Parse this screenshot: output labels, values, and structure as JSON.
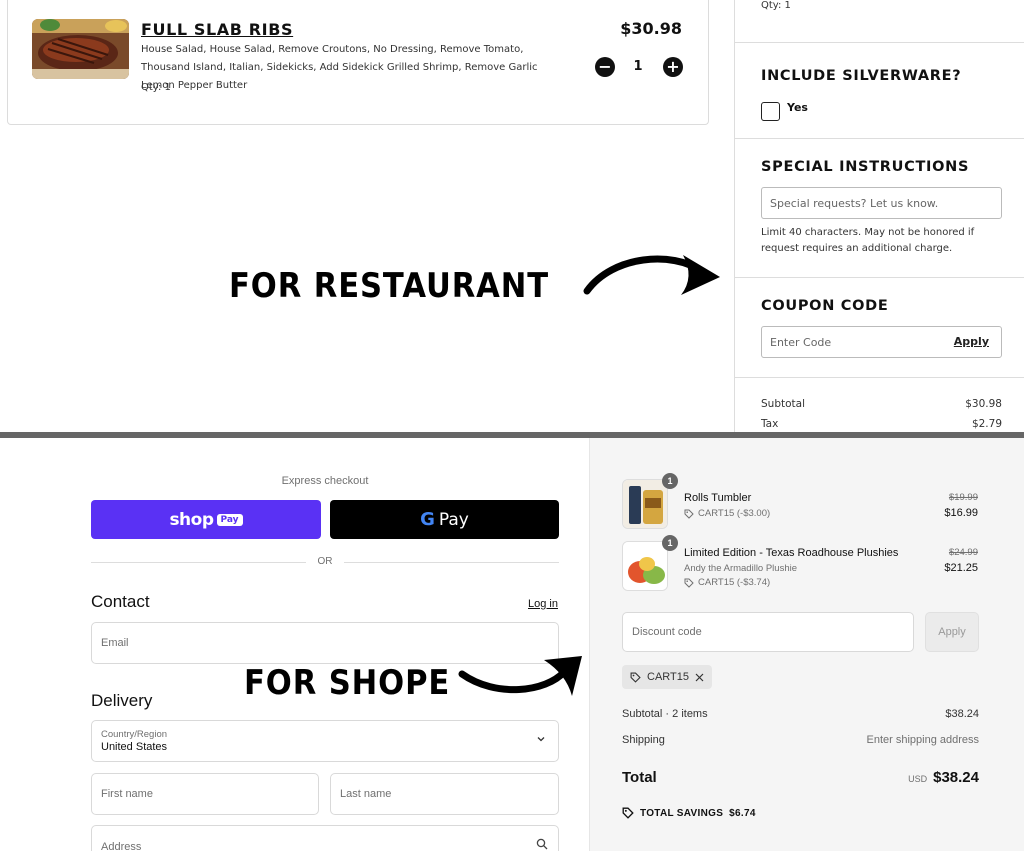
{
  "restaurant": {
    "label": "FOR RESTAURANT",
    "item": {
      "title": "FULL SLAB RIBS",
      "description": "House Salad, House Salad, Remove Croutons, No Dressing, Remove Tomato, Thousand Island, Italian, Sidekicks, Add Sidekick Grilled Shrimp, Remove Garlic Lemon Pepper Butter",
      "qty": "Qty: 1",
      "price": "$30.98",
      "quantity": "1",
      "minus": "−",
      "plus": "+"
    },
    "sidebar": {
      "prev_qty": "Qty: 1",
      "silverware_heading": "INCLUDE SILVERWARE?",
      "silverware_option": "Yes",
      "instructions_heading": "SPECIAL INSTRUCTIONS",
      "instructions_placeholder": "Special requests? Let us know.",
      "instructions_note": "Limit 40 characters. May not be honored if request requires an additional charge.",
      "coupon_heading": "COUPON CODE",
      "coupon_placeholder": "Enter Code",
      "coupon_apply": "Apply",
      "subtotal_label": "Subtotal",
      "subtotal_value": "$30.98",
      "tax_label": "Tax",
      "tax_value": "$2.79"
    }
  },
  "shop": {
    "label": "FOR SHOPE",
    "express_label": "Express checkout",
    "shop_pay": {
      "shop": "shop",
      "pay": "Pay"
    },
    "gpay": {
      "g": "G",
      "pay": "Pay"
    },
    "or": "OR",
    "contact": {
      "title": "Contact",
      "login": "Log in",
      "email_placeholder": "Email"
    },
    "delivery": {
      "title": "Delivery",
      "country_label": "Country/Region",
      "country_value": "United States",
      "first_name": "First name",
      "last_name": "Last name",
      "address": "Address"
    },
    "summary": {
      "products": [
        {
          "badge": "1",
          "name": "Rolls Tumbler",
          "variant": "",
          "discount": "CART15 (-$3.00)",
          "old_price": "$19.99",
          "price": "$16.99"
        },
        {
          "badge": "1",
          "name": "Limited Edition - Texas Roadhouse Plushies",
          "variant": "Andy the Armadillo Plushie",
          "discount": "CART15 (-$3.74)",
          "old_price": "$24.99",
          "price": "$21.25"
        }
      ],
      "discount_placeholder": "Discount code",
      "apply": "Apply",
      "applied_code": "CART15",
      "subtotal_label": "Subtotal · 2 items",
      "subtotal_value": "$38.24",
      "shipping_label": "Shipping",
      "shipping_value": "Enter shipping address",
      "total_label": "Total",
      "currency": "USD",
      "total_value": "$38.24",
      "savings_label": "TOTAL SAVINGS",
      "savings_value": "$6.74"
    }
  },
  "colors": {
    "shop_pay": "#5a31f4",
    "gpay": "#000000",
    "summary_bg": "#f5f5f5"
  }
}
